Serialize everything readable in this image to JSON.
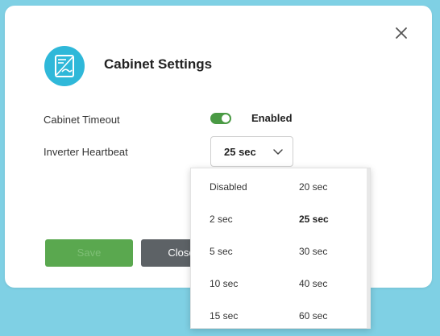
{
  "dialog": {
    "title": "Cabinet Settings"
  },
  "settings": {
    "cabinet_timeout": {
      "label": "Cabinet Timeout",
      "state": "Enabled"
    },
    "inverter_heartbeat": {
      "label": "Inverter Heartbeat",
      "selected": "25 sec",
      "options": [
        "Disabled",
        "20 sec",
        "2 sec",
        "25 sec",
        "5 sec",
        "30 sec",
        "10 sec",
        "40 sec",
        "15 sec",
        "60 sec"
      ]
    }
  },
  "buttons": {
    "save": "Save",
    "close": "Close"
  },
  "colors": {
    "background": "#7fd0e4",
    "icon_circle": "#2fb8d9",
    "toggle_on": "#4a9a44",
    "save_button": "#5aa84f",
    "close_button": "#5d6266"
  },
  "icons": {
    "close": "close-icon",
    "header": "cabinet-settings-icon",
    "dropdown_arrow": "chevron-down-icon"
  }
}
